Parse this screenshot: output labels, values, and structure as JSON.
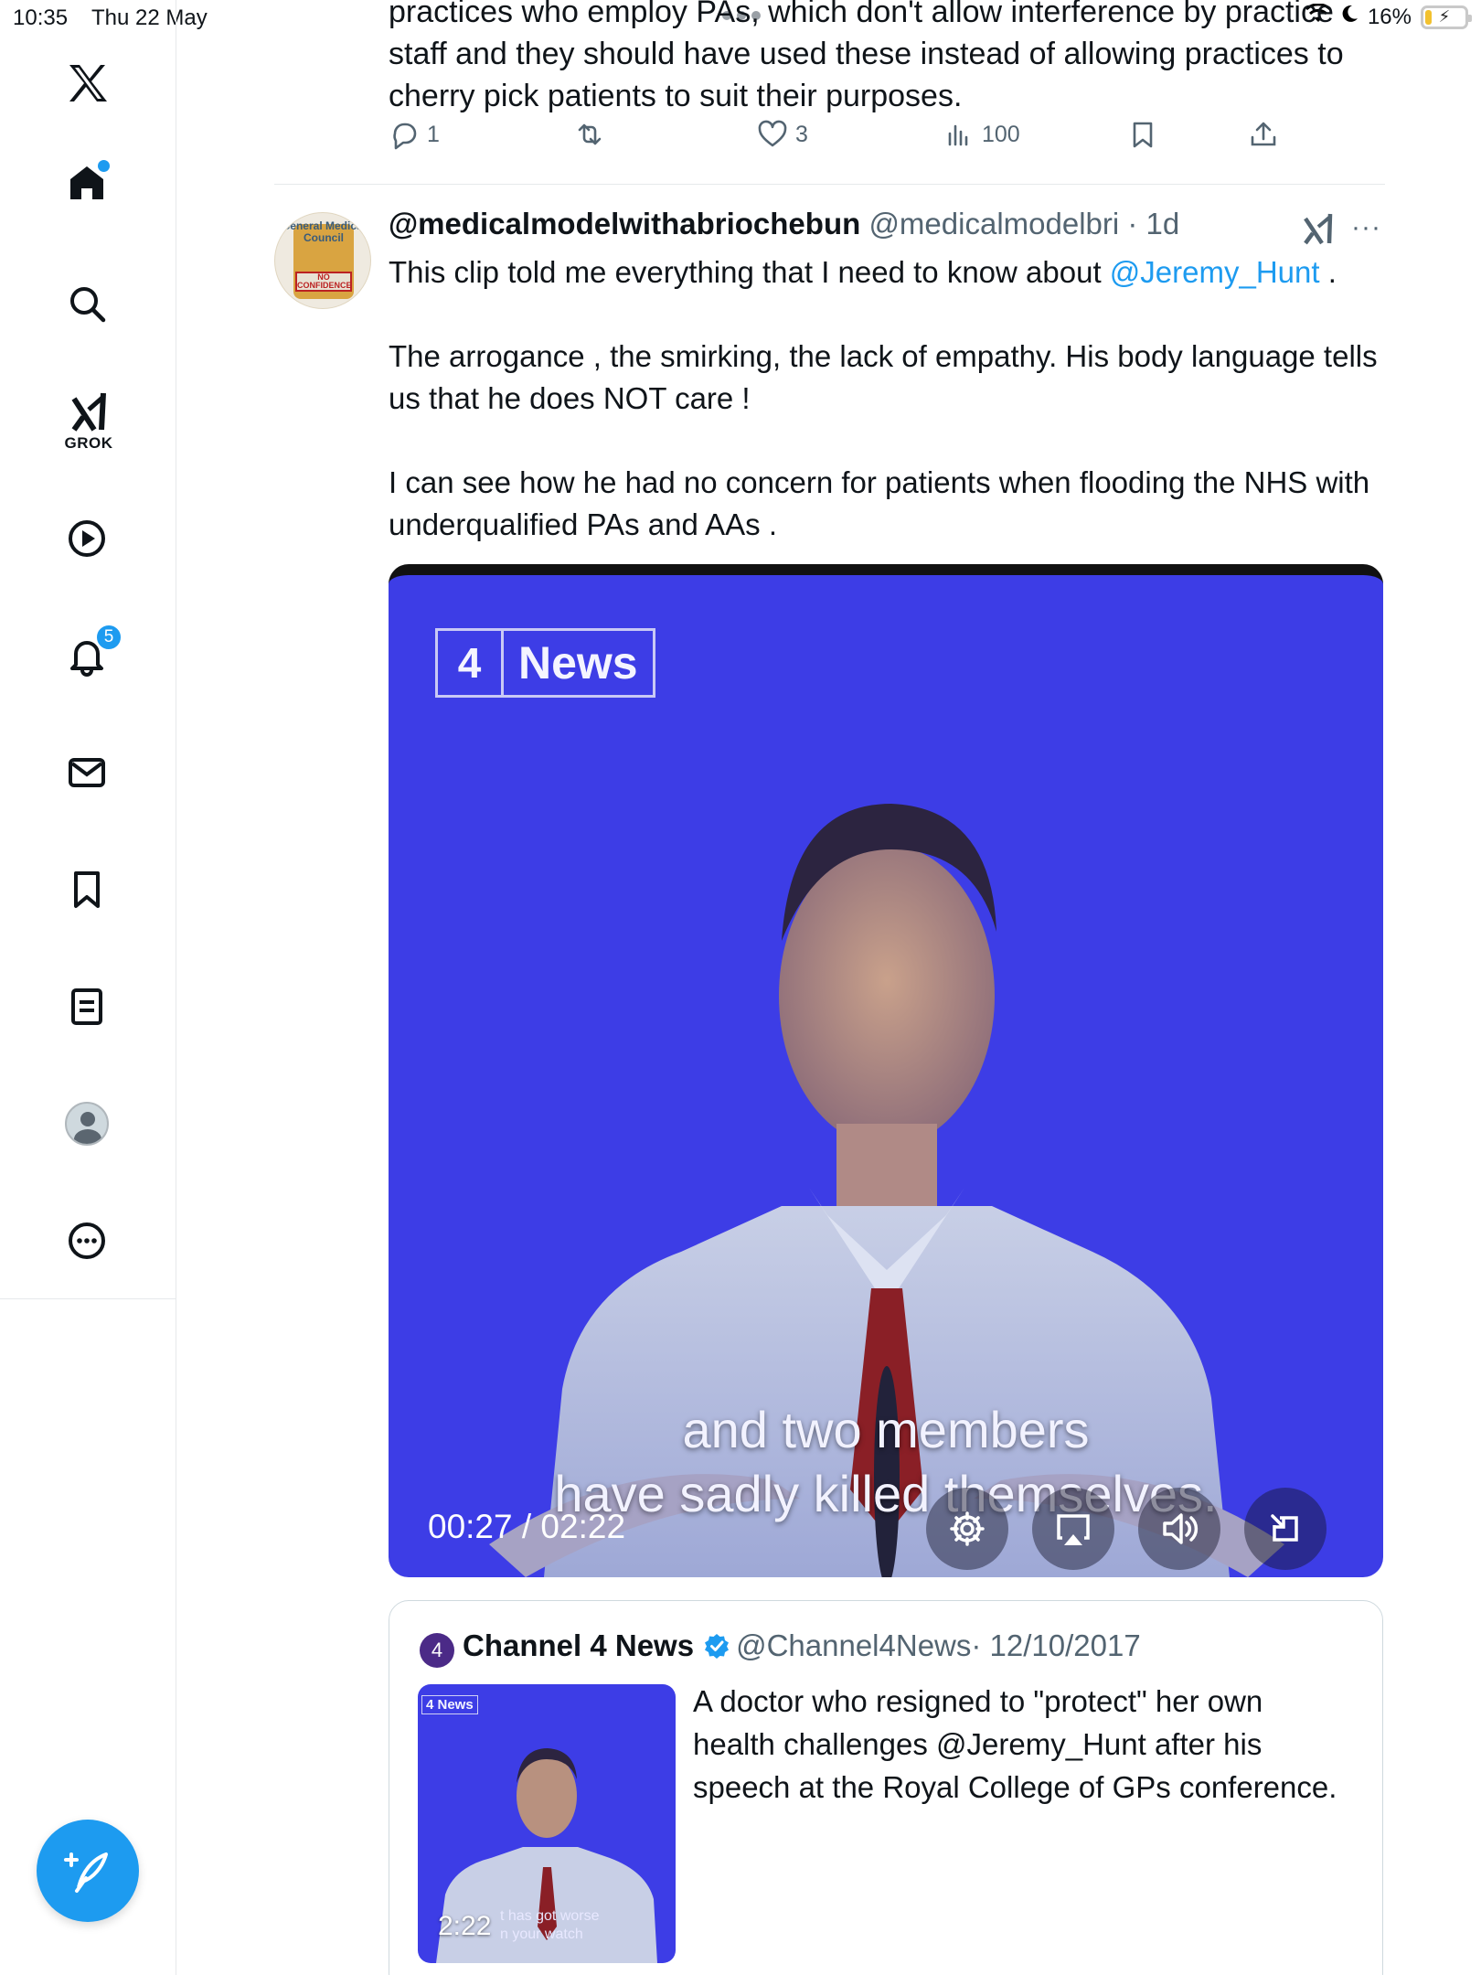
{
  "status_bar": {
    "time": "10:35",
    "date": "Thu 22 May",
    "battery": "16%",
    "battery_level": 0.16
  },
  "sidebar": {
    "logo": "X",
    "notification_badge": "5",
    "grok_label": "GROK",
    "items": [
      "home-icon",
      "search-icon",
      "grok-icon",
      "video-icon",
      "notifications-icon",
      "messages-icon",
      "bookmarks-icon",
      "lists-icon",
      "profile-icon",
      "more-icon"
    ],
    "compose_icon": "compose-icon"
  },
  "previous_post": {
    "text": "practices who employ PAs, which don't allow interference by practice staff and they should have used these instead of allowing practices to cherry pick patients to suit their purposes.",
    "replies": "1",
    "reposts": "",
    "likes": "3",
    "views": "100"
  },
  "post": {
    "display_name": "@medicalmodelwithabriochebun",
    "handle": "@medicalmodelbri",
    "time": "· 1d",
    "more": "···",
    "avatar_text": "General Medical Council",
    "avatar_sign": "NO CONFIDENCE",
    "paragraph1_before": "This clip told me everything that I need to know about ",
    "paragraph1_mention": "@Jeremy_Hunt",
    "paragraph1_after": " .",
    "paragraph2": "The arrogance , the smirking, the lack of empathy. His body language tells us that he does NOT care !",
    "paragraph3": "I can see how he had no concern for patients  when  flooding the NHS with underqualified PAs and AAs ."
  },
  "video": {
    "logo_number": "4",
    "logo_text": "News",
    "subtitle_line1": "and two members",
    "subtitle_line2": "have sadly killed themselves.",
    "time_display": "00:27 / 02:22",
    "controls": [
      "settings-icon",
      "airplay-icon",
      "volume-icon",
      "exit-fullscreen-icon"
    ]
  },
  "quoted_post": {
    "logo_number": "4",
    "display_name": "Channel 4 News",
    "handle": "@Channel4News",
    "date": "· 12/10/2017",
    "thumb_logo": "4 News",
    "duration": "2:22",
    "thumb_subtitle_1": "t has got worse",
    "thumb_subtitle_2": "n your watch",
    "text": "A doctor who resigned to \"protect\" her own health challenges @Jeremy_Hunt after his speech at the Royal College of GPs conference."
  },
  "colors": {
    "accent": "#1d9bf0",
    "video_bg": "#3d3de6",
    "text_primary": "#0f1419",
    "text_secondary": "#536471"
  }
}
